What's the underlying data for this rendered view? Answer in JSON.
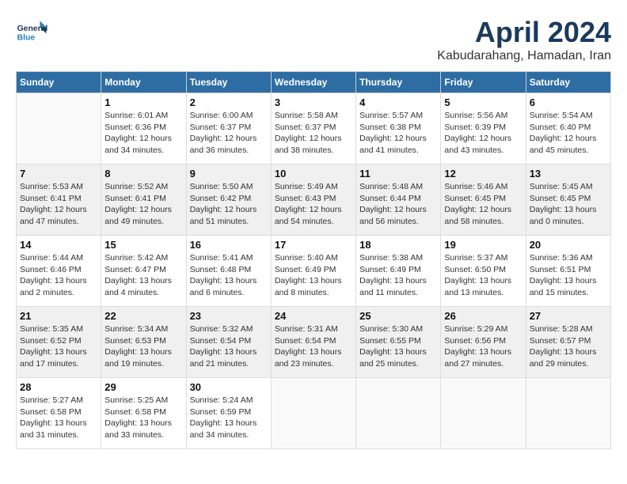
{
  "header": {
    "logo_line1": "General",
    "logo_line2": "Blue",
    "month": "April 2024",
    "location": "Kabudarahang, Hamadan, Iran"
  },
  "weekdays": [
    "Sunday",
    "Monday",
    "Tuesday",
    "Wednesday",
    "Thursday",
    "Friday",
    "Saturday"
  ],
  "weeks": [
    {
      "shaded": false,
      "days": [
        {
          "empty": true
        },
        {
          "num": "1",
          "sunrise": "6:01 AM",
          "sunset": "6:36 PM",
          "daylight": "12 hours and 34 minutes."
        },
        {
          "num": "2",
          "sunrise": "6:00 AM",
          "sunset": "6:37 PM",
          "daylight": "12 hours and 36 minutes."
        },
        {
          "num": "3",
          "sunrise": "5:58 AM",
          "sunset": "6:37 PM",
          "daylight": "12 hours and 38 minutes."
        },
        {
          "num": "4",
          "sunrise": "5:57 AM",
          "sunset": "6:38 PM",
          "daylight": "12 hours and 41 minutes."
        },
        {
          "num": "5",
          "sunrise": "5:56 AM",
          "sunset": "6:39 PM",
          "daylight": "12 hours and 43 minutes."
        },
        {
          "num": "6",
          "sunrise": "5:54 AM",
          "sunset": "6:40 PM",
          "daylight": "12 hours and 45 minutes."
        }
      ]
    },
    {
      "shaded": true,
      "days": [
        {
          "num": "7",
          "sunrise": "5:53 AM",
          "sunset": "6:41 PM",
          "daylight": "12 hours and 47 minutes."
        },
        {
          "num": "8",
          "sunrise": "5:52 AM",
          "sunset": "6:41 PM",
          "daylight": "12 hours and 49 minutes."
        },
        {
          "num": "9",
          "sunrise": "5:50 AM",
          "sunset": "6:42 PM",
          "daylight": "12 hours and 51 minutes."
        },
        {
          "num": "10",
          "sunrise": "5:49 AM",
          "sunset": "6:43 PM",
          "daylight": "12 hours and 54 minutes."
        },
        {
          "num": "11",
          "sunrise": "5:48 AM",
          "sunset": "6:44 PM",
          "daylight": "12 hours and 56 minutes."
        },
        {
          "num": "12",
          "sunrise": "5:46 AM",
          "sunset": "6:45 PM",
          "daylight": "12 hours and 58 minutes."
        },
        {
          "num": "13",
          "sunrise": "5:45 AM",
          "sunset": "6:45 PM",
          "daylight": "13 hours and 0 minutes."
        }
      ]
    },
    {
      "shaded": false,
      "days": [
        {
          "num": "14",
          "sunrise": "5:44 AM",
          "sunset": "6:46 PM",
          "daylight": "13 hours and 2 minutes."
        },
        {
          "num": "15",
          "sunrise": "5:42 AM",
          "sunset": "6:47 PM",
          "daylight": "13 hours and 4 minutes."
        },
        {
          "num": "16",
          "sunrise": "5:41 AM",
          "sunset": "6:48 PM",
          "daylight": "13 hours and 6 minutes."
        },
        {
          "num": "17",
          "sunrise": "5:40 AM",
          "sunset": "6:49 PM",
          "daylight": "13 hours and 8 minutes."
        },
        {
          "num": "18",
          "sunrise": "5:38 AM",
          "sunset": "6:49 PM",
          "daylight": "13 hours and 11 minutes."
        },
        {
          "num": "19",
          "sunrise": "5:37 AM",
          "sunset": "6:50 PM",
          "daylight": "13 hours and 13 minutes."
        },
        {
          "num": "20",
          "sunrise": "5:36 AM",
          "sunset": "6:51 PM",
          "daylight": "13 hours and 15 minutes."
        }
      ]
    },
    {
      "shaded": true,
      "days": [
        {
          "num": "21",
          "sunrise": "5:35 AM",
          "sunset": "6:52 PM",
          "daylight": "13 hours and 17 minutes."
        },
        {
          "num": "22",
          "sunrise": "5:34 AM",
          "sunset": "6:53 PM",
          "daylight": "13 hours and 19 minutes."
        },
        {
          "num": "23",
          "sunrise": "5:32 AM",
          "sunset": "6:54 PM",
          "daylight": "13 hours and 21 minutes."
        },
        {
          "num": "24",
          "sunrise": "5:31 AM",
          "sunset": "6:54 PM",
          "daylight": "13 hours and 23 minutes."
        },
        {
          "num": "25",
          "sunrise": "5:30 AM",
          "sunset": "6:55 PM",
          "daylight": "13 hours and 25 minutes."
        },
        {
          "num": "26",
          "sunrise": "5:29 AM",
          "sunset": "6:56 PM",
          "daylight": "13 hours and 27 minutes."
        },
        {
          "num": "27",
          "sunrise": "5:28 AM",
          "sunset": "6:57 PM",
          "daylight": "13 hours and 29 minutes."
        }
      ]
    },
    {
      "shaded": false,
      "days": [
        {
          "num": "28",
          "sunrise": "5:27 AM",
          "sunset": "6:58 PM",
          "daylight": "13 hours and 31 minutes."
        },
        {
          "num": "29",
          "sunrise": "5:25 AM",
          "sunset": "6:58 PM",
          "daylight": "13 hours and 33 minutes."
        },
        {
          "num": "30",
          "sunrise": "5:24 AM",
          "sunset": "6:59 PM",
          "daylight": "13 hours and 34 minutes."
        },
        {
          "empty": true
        },
        {
          "empty": true
        },
        {
          "empty": true
        },
        {
          "empty": true
        }
      ]
    }
  ]
}
